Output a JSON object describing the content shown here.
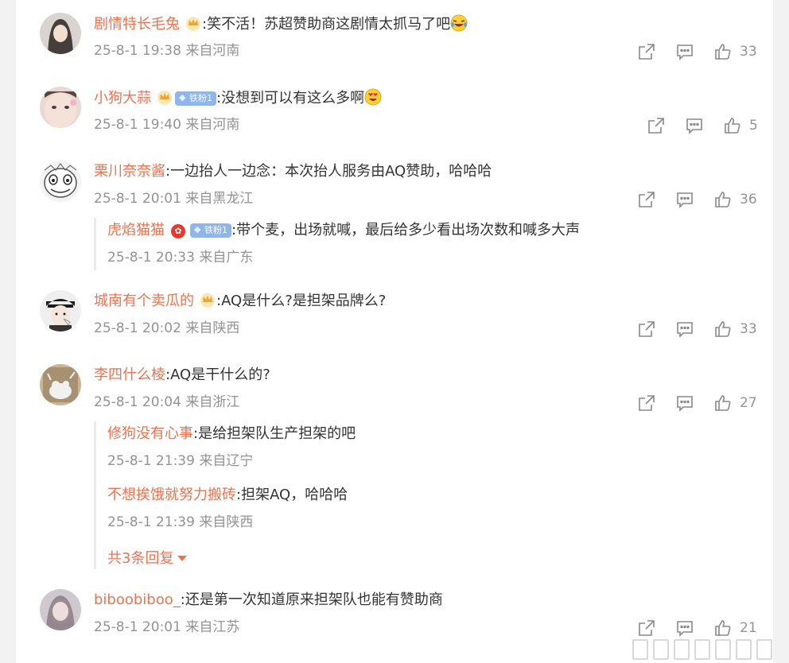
{
  "colors": {
    "username": "#eb7350",
    "meta": "#939393",
    "text": "#333333"
  },
  "comments": [
    {
      "username": "剧情特长毛兔",
      "text": ":笑不活！苏超赞助商这剧情太抓马了吧",
      "emoji": "laughing-crying-emoji",
      "time": "25-8-1 19:38",
      "location": "来自河南",
      "likes": "33"
    },
    {
      "username": "小狗大蒜",
      "badge_fan": "铁粉1",
      "text": ":没想到可以有这么多啊",
      "emoji": "heart-eyes-emoji",
      "time": "25-8-1 19:40",
      "location": "来自河南",
      "likes": "5"
    },
    {
      "username": "栗川奈奈酱",
      "text": ":一边抬人一边念：本次抬人服务由AQ赞助，哈哈哈",
      "time": "25-8-1 20:01",
      "location": "来自黑龙江",
      "likes": "36",
      "replies": [
        {
          "username": "虎焰猫猫",
          "badge_fan": "铁粉1",
          "text": ":带个麦，出场就喊，最后给多少看出场次数和喊多大声",
          "time": "25-8-1 20:33",
          "location": "来自广东"
        }
      ]
    },
    {
      "username": "城南有个卖瓜的",
      "text": ":AQ是什么?是担架品牌么?",
      "time": "25-8-1 20:02",
      "location": "来自陕西",
      "likes": "33"
    },
    {
      "username": "李四什么棱",
      "text": ":AQ是干什么的?",
      "time": "25-8-1 20:04",
      "location": "来自浙江",
      "likes": "27",
      "replies": [
        {
          "username": "修狗没有心事",
          "text": ":是给担架队生产担架的吧",
          "time": "25-8-1 21:39",
          "location": "来自辽宁"
        },
        {
          "username": "不想挨饿就努力搬砖",
          "text": ":担架AQ，哈哈哈",
          "time": "25-8-1 21:39",
          "location": "来自陕西"
        }
      ],
      "more_replies": "共3条回复"
    },
    {
      "username": "biboobiboo_",
      "text": ":还是第一次知道原来担架队也能有赞助商",
      "time": "25-8-1 20:01",
      "location": "来自江苏",
      "likes": "21"
    }
  ]
}
